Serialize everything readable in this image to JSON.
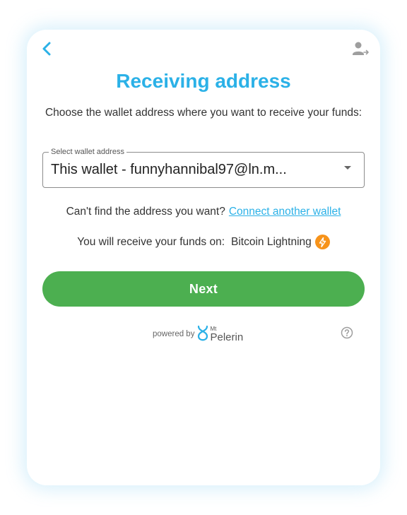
{
  "header": {
    "back_icon": "chevron-left-icon",
    "account_icon": "user-arrow-icon"
  },
  "title": "Receiving address",
  "subtitle": "Choose the wallet address where you want to receive your funds:",
  "wallet_select": {
    "label": "Select wallet address",
    "value": "This wallet - funnyhannibal97@ln.m..."
  },
  "find_address": {
    "text": "Can't find the address you want?",
    "link": "Connect another wallet"
  },
  "receive": {
    "text": "You will receive your funds on:",
    "network": "Bitcoin Lightning",
    "network_icon": "lightning-bolt-icon"
  },
  "next_button": "Next",
  "footer": {
    "powered_by": "powered by",
    "brand_prefix": "Mt",
    "brand_name": "Pelerin",
    "help_icon": "help-circle-icon"
  },
  "colors": {
    "accent": "#2bb1e7",
    "button": "#4caf50",
    "lightning": "#f7931a"
  }
}
